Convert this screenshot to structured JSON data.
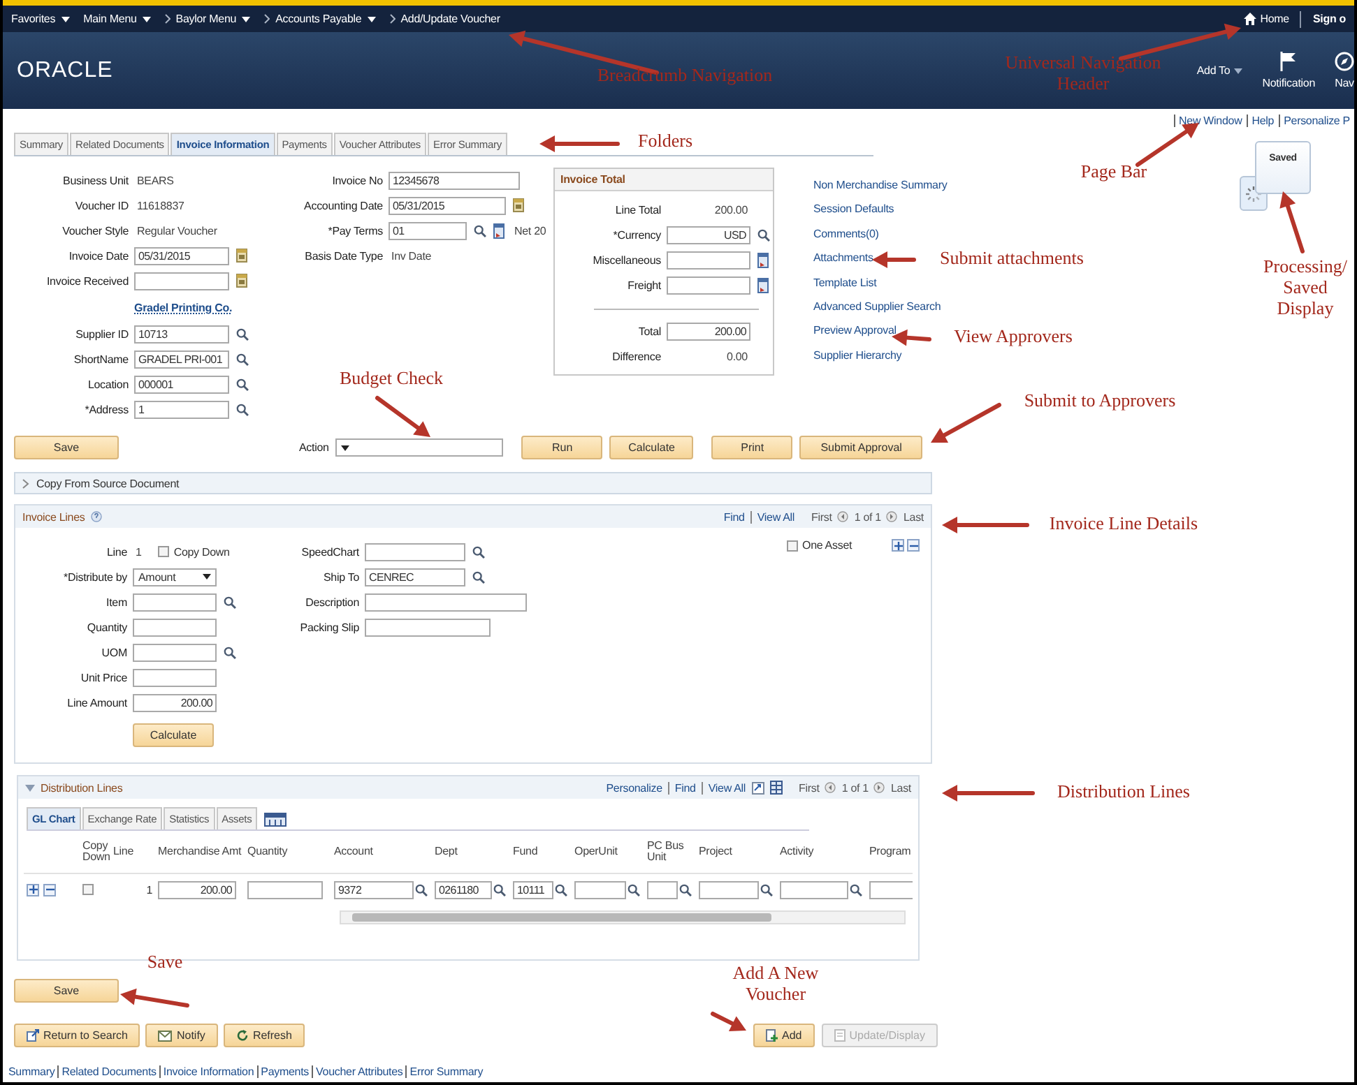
{
  "top_bar": {
    "items": [
      {
        "label": "Favorites",
        "kind": "menu"
      },
      {
        "label": "Main Menu",
        "kind": "menu"
      },
      {
        "label": "Baylor Menu",
        "kind": "crumb-menu"
      },
      {
        "label": "Accounts Payable",
        "kind": "crumb-menu"
      },
      {
        "label": "Add/Update Voucher",
        "kind": "crumb"
      }
    ],
    "home": "Home",
    "sign_out": "Sign o"
  },
  "header": {
    "logo": "ORACLE",
    "add_to": "Add To",
    "notification": "Notification",
    "navbar": "Nav"
  },
  "page_bar": [
    "New Window",
    "Help",
    "Personalize P"
  ],
  "saved_popup": {
    "text": "Saved"
  },
  "tabs": [
    {
      "label": "Summary",
      "selected": false
    },
    {
      "label": "Related Documents",
      "selected": false
    },
    {
      "label": "Invoice Information",
      "selected": true
    },
    {
      "label": "Payments",
      "selected": false
    },
    {
      "label": "Voucher Attributes",
      "selected": false
    },
    {
      "label": "Error Summary",
      "selected": false
    }
  ],
  "voucher": {
    "left": [
      {
        "label": "Business Unit",
        "kind": "display",
        "value": "BEARS"
      },
      {
        "label": "Voucher ID",
        "kind": "display",
        "value": "11618837"
      },
      {
        "label": "Voucher Style",
        "kind": "display",
        "value": "Regular Voucher"
      },
      {
        "label": "Invoice Date",
        "kind": "date",
        "value": "05/31/2015"
      },
      {
        "label": "Invoice Received",
        "kind": "date"
      }
    ],
    "supplier_link": "Gradel Printing Co.",
    "supplier": [
      {
        "label": "Supplier ID",
        "kind": "lookup",
        "value": "10713"
      },
      {
        "label": "ShortName",
        "kind": "lookup",
        "value": "GRADEL PRI-001"
      },
      {
        "label": "Location",
        "kind": "lookup",
        "value": "000001"
      },
      {
        "label": "*Address",
        "kind": "lookup",
        "value": "1"
      }
    ],
    "middle": [
      {
        "label": "Invoice No",
        "kind": "text",
        "value": "12345678"
      },
      {
        "label": "Accounting Date",
        "kind": "date",
        "value": "05/31/2015"
      },
      {
        "label": "*Pay Terms",
        "kind": "terms",
        "value": "01",
        "note": "Net 20"
      },
      {
        "label": "Basis Date Type",
        "kind": "display",
        "value": "Inv Date"
      }
    ]
  },
  "invoice_total": {
    "title": "Invoice Total",
    "rows": [
      {
        "label": "Line Total",
        "kind": "display",
        "value": "200.00"
      },
      {
        "label": "*Currency",
        "kind": "lookup",
        "value": "USD"
      },
      {
        "label": "Miscellaneous",
        "kind": "detail"
      },
      {
        "label": "Freight",
        "kind": "detail"
      }
    ],
    "totals": [
      {
        "label": "Total",
        "kind": "text",
        "value": "200.00"
      },
      {
        "label": "Difference",
        "kind": "display",
        "value": "0.00"
      }
    ]
  },
  "links": [
    "Non Merchandise Summary",
    "Session Defaults",
    "Comments(0)",
    "Attachments",
    "Template List",
    "Advanced Supplier Search",
    "Preview Approval",
    "Supplier Hierarchy"
  ],
  "actions": {
    "save": "Save",
    "action_label": "Action",
    "buttons": [
      "Run",
      "Calculate",
      "Print",
      "Submit Approval"
    ]
  },
  "copy_section": {
    "title": "Copy From Source Document",
    "expanded": false
  },
  "invoice_lines": {
    "title": "Invoice Lines",
    "nav": {
      "find": "Find",
      "view_all": "View All",
      "first": "First",
      "count": "1 of 1",
      "last": "Last"
    },
    "line_label": "Line",
    "line_no": "1",
    "copy_down": {
      "label": "Copy Down",
      "checked": false
    },
    "left": [
      {
        "label": "*Distribute by",
        "kind": "select",
        "value": "Amount"
      },
      {
        "label": "Item",
        "kind": "lookup"
      },
      {
        "label": "Quantity",
        "kind": "text"
      },
      {
        "label": "UOM",
        "kind": "lookup"
      },
      {
        "label": "Unit Price",
        "kind": "text"
      },
      {
        "label": "Line Amount",
        "kind": "amount",
        "value": "200.00"
      }
    ],
    "calculate": "Calculate",
    "middle": [
      {
        "label": "SpeedChart",
        "kind": "lookup"
      },
      {
        "label": "Ship To",
        "kind": "lookup",
        "value": "CENREC"
      },
      {
        "label": "Description",
        "kind": "text"
      },
      {
        "label": "Packing Slip",
        "kind": "text"
      }
    ],
    "one_asset": {
      "label": "One Asset",
      "checked": false
    }
  },
  "distribution_lines": {
    "title": "Distribution Lines",
    "expanded": true,
    "nav": {
      "personalize": "Personalize",
      "find": "Find",
      "view_all": "View All",
      "first": "First",
      "count": "1 of 1",
      "last": "Last"
    },
    "tabs": [
      {
        "label": "GL Chart",
        "selected": true
      },
      {
        "label": "Exchange Rate",
        "selected": false
      },
      {
        "label": "Statistics",
        "selected": false
      },
      {
        "label": "Assets",
        "selected": false
      }
    ],
    "columns": [
      "Copy Down",
      "Line",
      "Merchandise Amt",
      "Quantity",
      "Account",
      "Dept",
      "Fund",
      "OperUnit",
      "PC Bus Unit",
      "Project",
      "Activity",
      "Program"
    ],
    "rows": [
      [
        {
          "kind": "checkbox",
          "checked": false
        },
        {
          "kind": "text",
          "value": "1"
        },
        {
          "kind": "amount",
          "value": "200.00"
        },
        {
          "kind": "input"
        },
        {
          "kind": "lookup",
          "value": "9372"
        },
        {
          "kind": "lookup",
          "value": "0261180"
        },
        {
          "kind": "lookup",
          "value": "10111"
        },
        {
          "kind": "lookup"
        },
        {
          "kind": "lookup"
        },
        {
          "kind": "lookup"
        },
        {
          "kind": "lookup"
        },
        {
          "kind": "input"
        }
      ]
    ]
  },
  "save": "Save",
  "toolbar": {
    "left": [
      {
        "label": "Return to Search",
        "kind": "return"
      },
      {
        "label": "Notify",
        "kind": "notify"
      },
      {
        "label": "Refresh",
        "kind": "refresh"
      }
    ],
    "right": [
      {
        "label": "Add",
        "kind": "add",
        "disabled": false
      },
      {
        "label": "Update/Display",
        "kind": "update",
        "disabled": true
      }
    ]
  },
  "footer_links": [
    "Summary",
    "Related Documents",
    "Invoice Information",
    "Payments",
    "Voucher Attributes",
    "Error Summary"
  ],
  "annotations": [
    {
      "text": "Breadcrumb Navigation"
    },
    {
      "text": "Universal Navigation Header"
    },
    {
      "text": "Folders"
    },
    {
      "text": "Page Bar"
    },
    {
      "text": "Submit attachments"
    },
    {
      "text": "View Approvers"
    },
    {
      "text": "Budget Check"
    },
    {
      "text": "Submit to Approvers"
    },
    {
      "text": "Processing/ Saved Display"
    },
    {
      "text": "Invoice Line Details"
    },
    {
      "text": "Distribution Lines"
    },
    {
      "text": "Save"
    },
    {
      "text": "Add A New Voucher"
    }
  ]
}
